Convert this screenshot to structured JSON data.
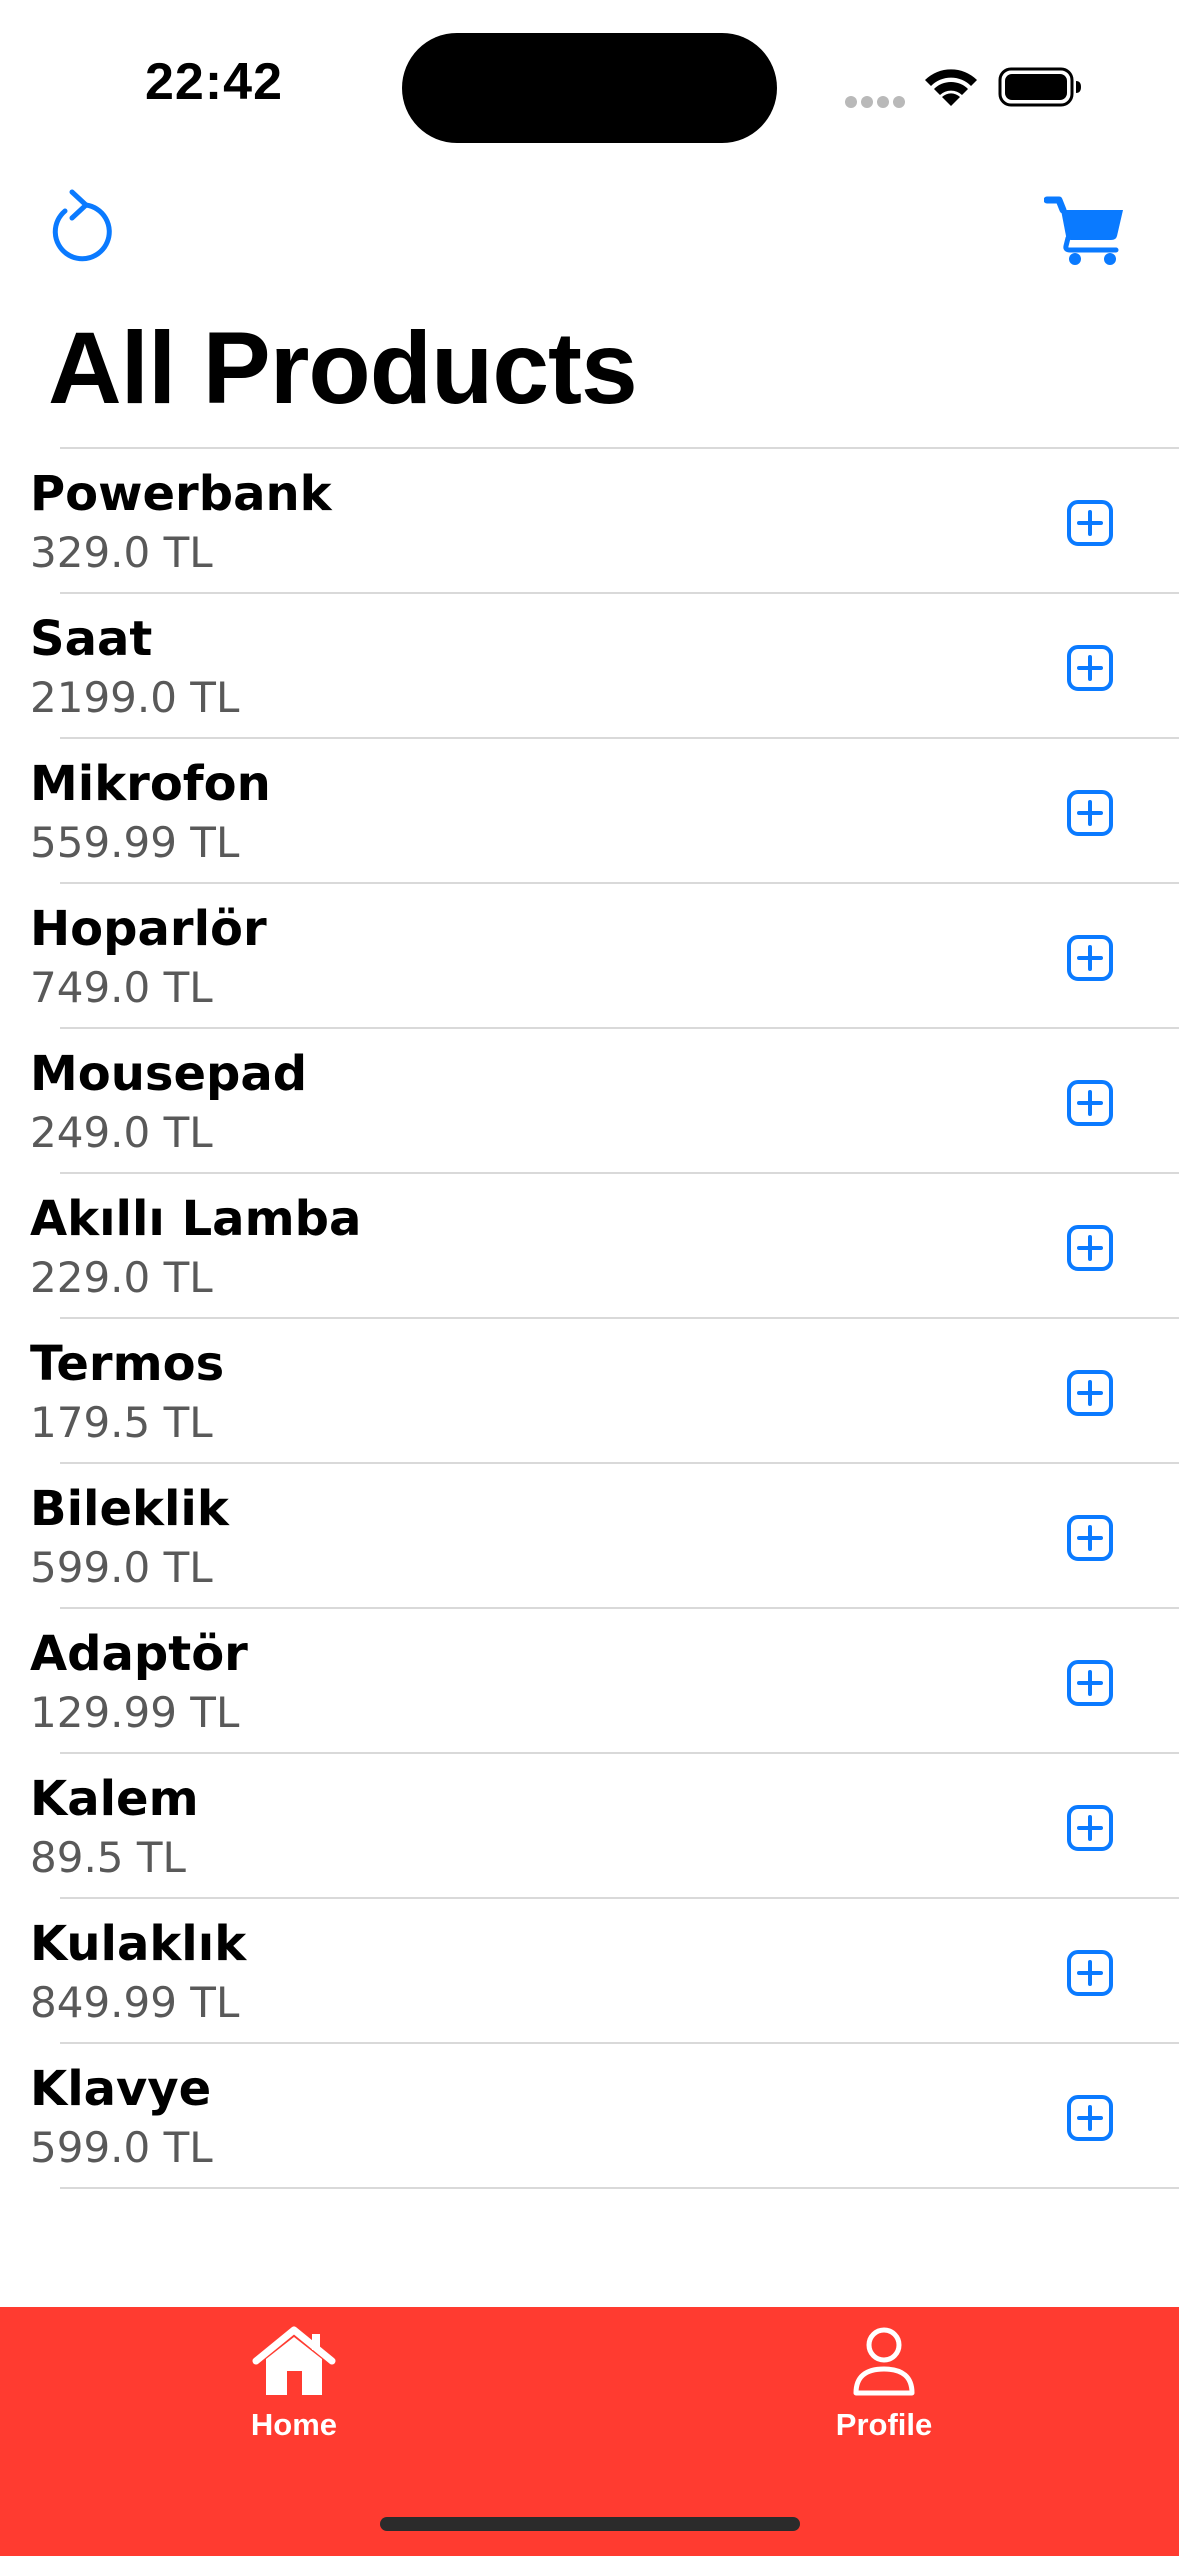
{
  "status_bar": {
    "time": "22:42"
  },
  "nav": {
    "title": "All Products",
    "refresh_icon": "arrow-clockwise-icon",
    "cart_icon": "cart-fill-icon"
  },
  "products": [
    {
      "name": "Powerbank",
      "price": "329.0 TL"
    },
    {
      "name": "Saat",
      "price": "2199.0 TL"
    },
    {
      "name": "Mikrofon",
      "price": "559.99 TL"
    },
    {
      "name": "Hoparlör",
      "price": "749.0 TL"
    },
    {
      "name": "Mousepad",
      "price": "249.0 TL"
    },
    {
      "name": "Akıllı Lamba",
      "price": "229.0 TL"
    },
    {
      "name": "Termos",
      "price": "179.5 TL"
    },
    {
      "name": "Bileklik",
      "price": "599.0 TL"
    },
    {
      "name": "Adaptör",
      "price": "129.99 TL"
    },
    {
      "name": "Kalem",
      "price": "89.5 TL"
    },
    {
      "name": "Kulaklık",
      "price": "849.99 TL"
    },
    {
      "name": "Klavye",
      "price": "599.0 TL"
    }
  ],
  "tab_bar": {
    "tabs": [
      {
        "label": "Home",
        "icon": "house-fill-icon"
      },
      {
        "label": "Profile",
        "icon": "person-icon"
      }
    ]
  },
  "colors": {
    "accent": "#0a7aff",
    "tab_bar_background": "#ff3b30",
    "tab_foreground": "#ffffff",
    "secondary_text": "#595959"
  }
}
